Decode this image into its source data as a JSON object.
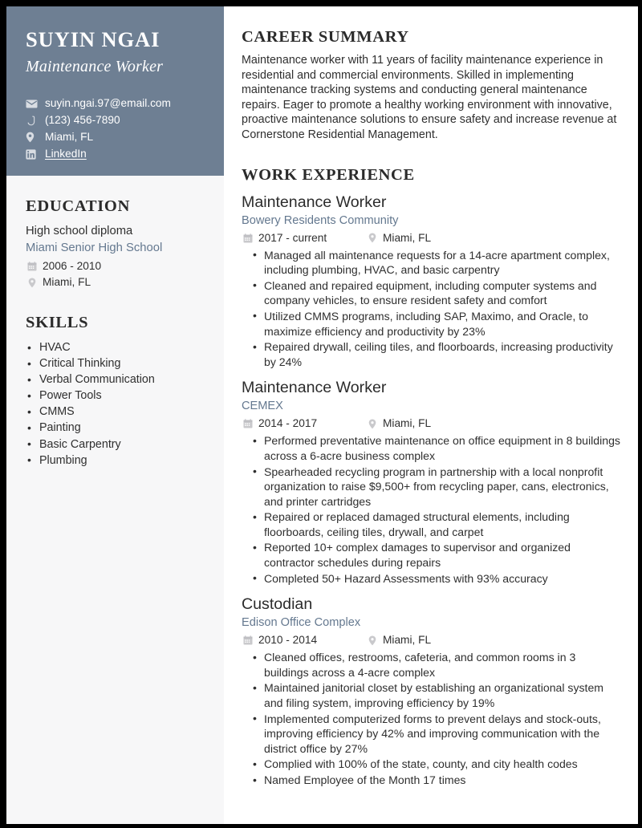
{
  "theme": {
    "sidebar_header_bg": "#6e7f93",
    "sidebar_body_bg": "#f7f7f8",
    "accent_link": "#64788f",
    "text": "#2f2f2f",
    "heading": "#2b2b2b",
    "page_bg": "#ffffff",
    "frame": "#000000"
  },
  "sidebar": {
    "name": "SUYIN NGAI",
    "role": "Maintenance Worker",
    "contacts": [
      {
        "icon": "envelope-icon",
        "text": "suyin.ngai.97@email.com",
        "is_link": false
      },
      {
        "icon": "phone-icon",
        "text": "(123) 456-7890",
        "is_link": false
      },
      {
        "icon": "location-pin-icon",
        "text": "Miami, FL",
        "is_link": false
      },
      {
        "icon": "linkedin-icon",
        "text": "LinkedIn",
        "is_link": true
      }
    ],
    "education": {
      "heading": "EDUCATION",
      "degree": "High school diploma",
      "school": "Miami Senior High School",
      "dates": "2006 - 2010",
      "location": "Miami, FL"
    },
    "skills": {
      "heading": "SKILLS",
      "items": [
        "HVAC",
        "Critical Thinking",
        "Verbal Communication",
        "Power Tools",
        "CMMS",
        "Painting",
        "Basic Carpentry",
        "Plumbing"
      ]
    }
  },
  "main": {
    "summary": {
      "heading": "CAREER SUMMARY",
      "text": "Maintenance worker with 11 years of facility maintenance experience in residential and commercial environments. Skilled in implementing maintenance tracking systems and conducting general maintenance repairs. Eager to promote a healthy working environment with innovative, proactive maintenance solutions to ensure safety and increase revenue at Cornerstone Residential Management."
    },
    "work": {
      "heading": "WORK EXPERIENCE",
      "jobs": [
        {
          "title": "Maintenance Worker",
          "company": "Bowery Residents Community",
          "dates": "2017 - current",
          "location": "Miami, FL",
          "bullets": [
            "Managed all maintenance requests for a 14-acre apartment complex, including plumbing, HVAC, and basic carpentry",
            "Cleaned and repaired equipment, including computer systems and company vehicles, to ensure resident safety and comfort",
            "Utilized CMMS programs, including SAP, Maximo, and Oracle, to maximize efficiency and productivity by 23%",
            "Repaired drywall, ceiling tiles, and floorboards, increasing productivity by 24%"
          ]
        },
        {
          "title": "Maintenance Worker",
          "company": "CEMEX",
          "dates": "2014 - 2017",
          "location": "Miami, FL",
          "bullets": [
            "Performed preventative maintenance on office equipment in 8 buildings across a 6-acre business complex",
            "Spearheaded recycling program in partnership with a local nonprofit organization to raise $9,500+ from recycling paper, cans, electronics, and printer cartridges",
            "Repaired or replaced damaged structural elements, including floorboards, ceiling tiles, drywall, and carpet",
            "Reported 10+ complex damages to supervisor and organized contractor schedules during repairs",
            "Completed 50+ Hazard Assessments with 93% accuracy"
          ]
        },
        {
          "title": "Custodian",
          "company": "Edison Office Complex",
          "dates": "2010 - 2014",
          "location": "Miami, FL",
          "bullets": [
            "Cleaned offices, restrooms, cafeteria, and common rooms in 3 buildings across a 4-acre complex",
            "Maintained janitorial closet by establishing an organizational system and filing system, improving efficiency by 19%",
            "Implemented computerized forms to prevent delays and stock-outs, improving efficiency by 42% and improving communication with the district office by 27%",
            "Complied with 100% of the state, county, and city health codes",
            "Named Employee of the Month 17 times"
          ]
        }
      ]
    }
  }
}
